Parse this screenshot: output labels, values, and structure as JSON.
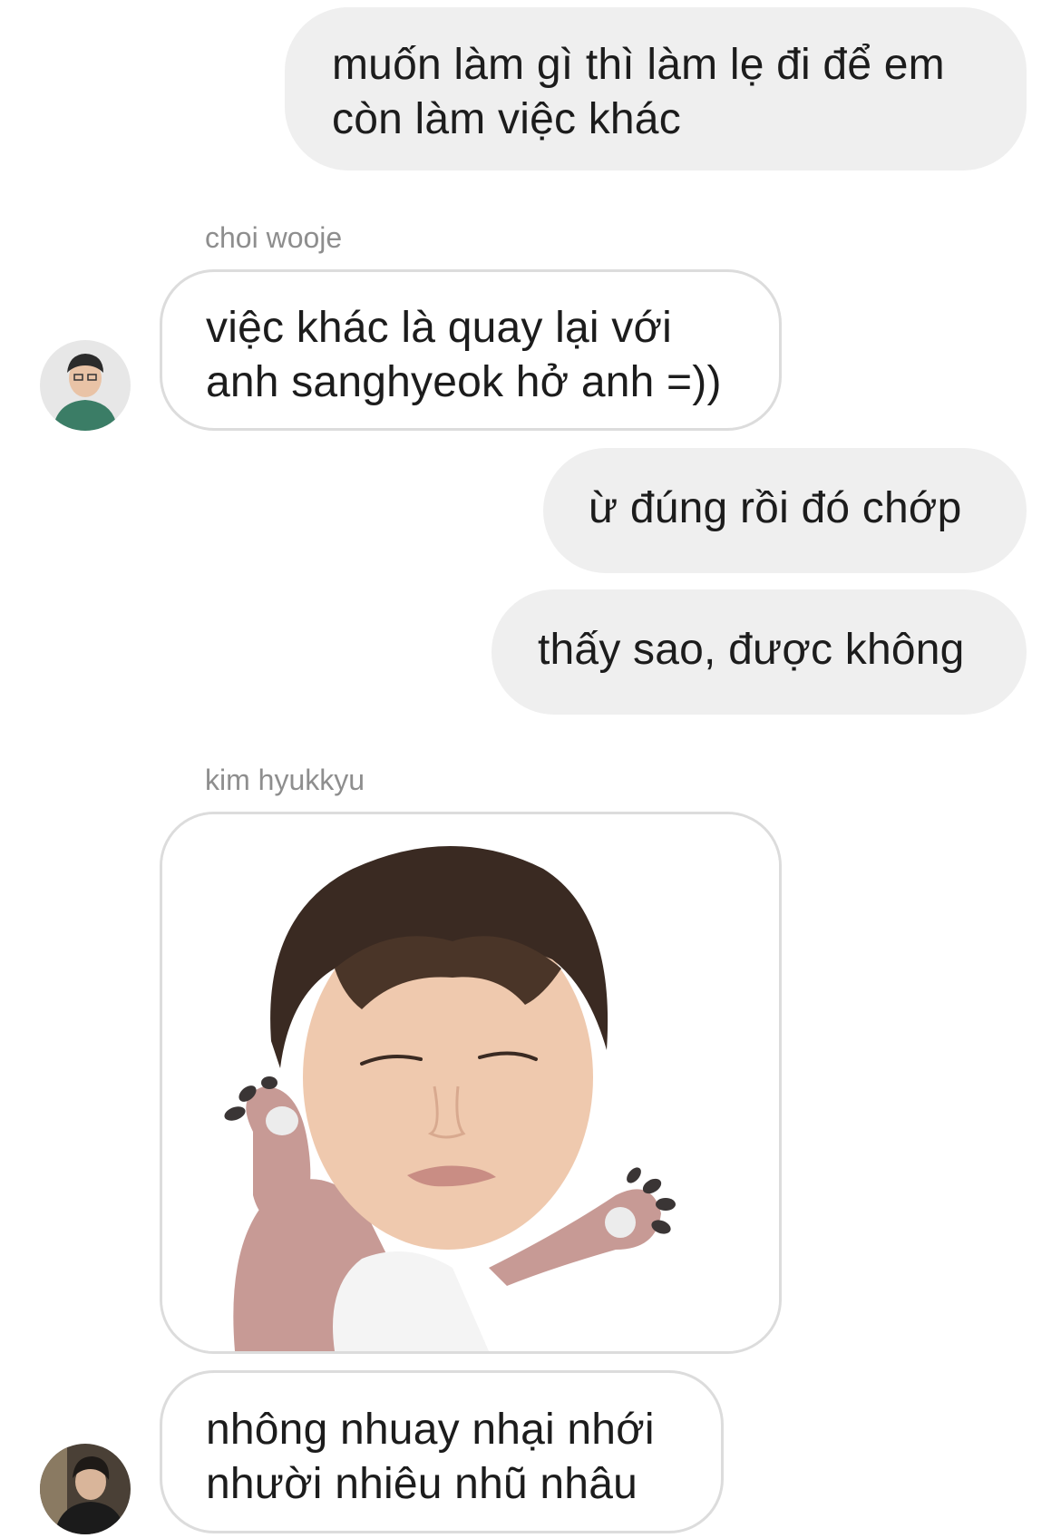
{
  "messages": {
    "m1": {
      "lines": [
        "muốn làm gì thì làm lẹ đi để em",
        "còn làm việc khác"
      ]
    },
    "m2_sender": "choi wooje",
    "m2": {
      "lines": [
        "việc khác là quay lại với",
        "anh sanghyeok hở anh =))"
      ]
    },
    "m3": {
      "text": "ừ đúng rồi đó chớp"
    },
    "m4": {
      "text": "thấy sao, được không"
    },
    "m5_sender": "kim hyukkyu",
    "m6": {
      "lines": [
        "nhông nhuay nhại nhới",
        "nhười nhiêu nhũ nhâu"
      ]
    }
  },
  "colors": {
    "outgoing_bubble": "#efefef",
    "incoming_border": "#dcdcdc",
    "sender_name": "#8e8e8e"
  },
  "icons": {
    "avatar_choi_wooje": "avatar-icon",
    "avatar_kim_hyukkyu": "avatar-icon",
    "sticker": "sticker-image"
  }
}
